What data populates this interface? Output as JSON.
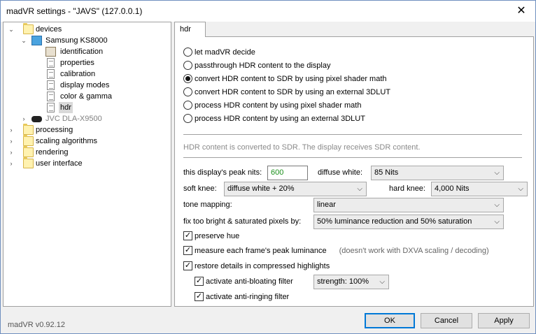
{
  "window": {
    "title": "madVR settings - \"JAVS\" (127.0.0.1)",
    "close_glyph": "✕"
  },
  "tree": {
    "devices": "devices",
    "samsung": "Samsung KS8000",
    "identification": "identification",
    "properties": "properties",
    "calibration": "calibration",
    "display_modes": "display modes",
    "color_gamma": "color & gamma",
    "hdr": "hdr",
    "jvc": "JVC DLA-X9500",
    "processing": "processing",
    "scaling": "scaling algorithms",
    "rendering": "rendering",
    "user_interface": "user interface"
  },
  "tab": {
    "label": "hdr"
  },
  "hdr_mode": {
    "options": [
      "let madVR decide",
      "passthrough HDR content to the display",
      "convert HDR content to SDR by using pixel shader math",
      "convert HDR content to SDR by using an external 3DLUT",
      "process HDR content by using pixel shader math",
      "process HDR content by using an external 3DLUT"
    ],
    "selected_index": 2
  },
  "info_text": "HDR content is converted to SDR. The display receives SDR content.",
  "peak_nits": {
    "label": "this display's peak nits:",
    "value": "600"
  },
  "diffuse_white": {
    "label": "diffuse white:",
    "value": "85 Nits"
  },
  "soft_knee": {
    "label": "soft knee:",
    "value": "diffuse white + 20%"
  },
  "hard_knee": {
    "label": "hard knee:",
    "value": "4,000 Nits"
  },
  "tone_mapping": {
    "label": "tone mapping:",
    "value": "linear"
  },
  "fix_pixels": {
    "label": "fix too bright & saturated pixels by:",
    "value": "50% luminance reduction and 50% saturation"
  },
  "checks": {
    "preserve_hue": "preserve hue",
    "measure_peak": "measure each frame's peak luminance",
    "measure_note": "(doesn't work with DXVA scaling / decoding)",
    "restore_details": "restore details in compressed highlights",
    "anti_bloating": "activate anti-bloating filter",
    "anti_ringing": "activate anti-ringing filter"
  },
  "strength": {
    "value": "strength: 100%"
  },
  "version": "madVR v0.92.12",
  "buttons": {
    "ok": "OK",
    "cancel": "Cancel",
    "apply": "Apply"
  }
}
